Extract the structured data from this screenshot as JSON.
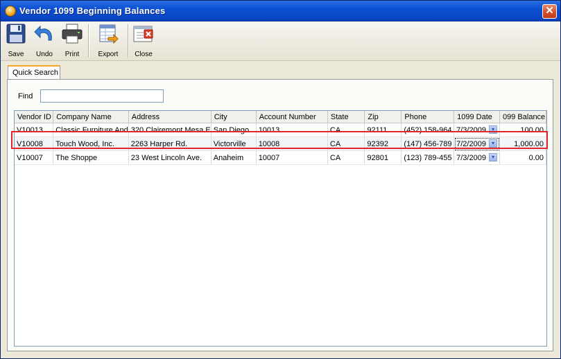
{
  "window": {
    "title": "Vendor 1099 Beginning Balances",
    "close_glyph": "✕"
  },
  "toolbar": {
    "buttons": [
      {
        "label": "Save",
        "icon": "floppy-disk-icon"
      },
      {
        "label": "Undo",
        "icon": "undo-arrow-icon"
      },
      {
        "label": "Print",
        "icon": "printer-icon"
      },
      {
        "label": "Export",
        "icon": "spreadsheet-export-icon"
      },
      {
        "label": "Close",
        "icon": "close-window-icon"
      }
    ]
  },
  "tabs": [
    {
      "label": "Quick Search",
      "active": true
    }
  ],
  "find": {
    "label": "Find",
    "value": ""
  },
  "grid": {
    "columns": [
      "Vendor ID",
      "Company Name",
      "Address",
      "City",
      "Account Number",
      "State",
      "Zip",
      "Phone",
      "1099 Date",
      "099 Balance"
    ],
    "rows": [
      {
        "vendor_id": "V10013",
        "company": "Classic Furniture And",
        "address": "320 Clairemont Mesa E",
        "city": "San Diego",
        "account": "10013",
        "state": "CA",
        "zip": "92111",
        "phone": "(452) 158-964",
        "date": "7/3/2009",
        "balance": "100.00"
      },
      {
        "vendor_id": "V10008",
        "company": "Touch Wood, Inc.",
        "address": "2263 Harper Rd.",
        "city": "Victorville",
        "account": "10008",
        "state": "CA",
        "zip": "92392",
        "phone": "(147) 456-789",
        "date": "7/2/2009",
        "balance": "1,000.00"
      },
      {
        "vendor_id": "V10007",
        "company": "The Shoppe",
        "address": "23 West Lincoln Ave.",
        "city": "Anaheim",
        "account": "10007",
        "state": "CA",
        "zip": "92801",
        "phone": "(123) 789-455",
        "date": "7/3/2009",
        "balance": "0.00"
      }
    ],
    "selected_row": 1,
    "dropdown_glyph": "▾"
  },
  "colors": {
    "title_bar": "#0b4fd2",
    "highlight": "#e0262a",
    "tab_accent": "#f6a522"
  }
}
